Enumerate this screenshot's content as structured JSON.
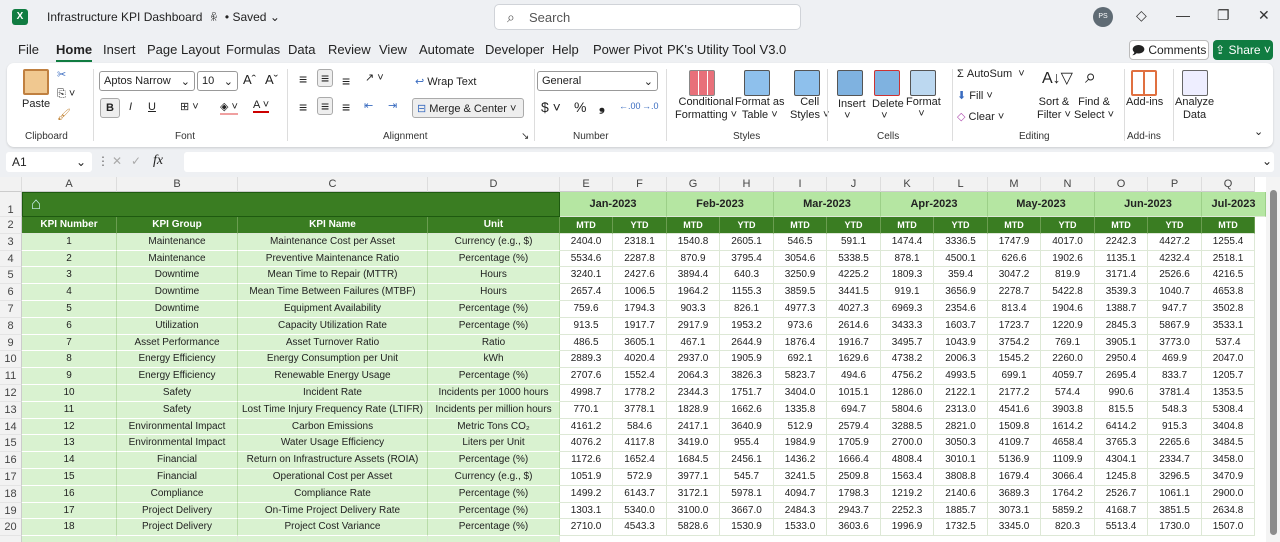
{
  "titlebar": {
    "app_icon": "excel-icon",
    "title": "Infrastructure KPI Dashboard",
    "status": "• Saved",
    "search_placeholder": "Search",
    "avatar": "PS"
  },
  "menu": {
    "tabs": [
      "File",
      "Home",
      "Insert",
      "Page Layout",
      "Formulas",
      "Data",
      "Review",
      "View",
      "Automate",
      "Developer",
      "Help",
      "Power Pivot",
      "PK's Utility Tool V3.0"
    ],
    "active": "Home",
    "comments": "Comments",
    "share": "Share"
  },
  "ribbon": {
    "clipboard": {
      "paste": "Paste",
      "label": "Clipboard"
    },
    "font": {
      "name": "Aptos Narrow",
      "size": "10",
      "label": "Font",
      "bold": "B",
      "italic": "I",
      "underline": "U"
    },
    "alignment": {
      "wrap": "Wrap Text",
      "merge": "Merge & Center",
      "label": "Alignment"
    },
    "number": {
      "format": "General",
      "label": "Number"
    },
    "styles": {
      "conditional": [
        "Conditional",
        "Formatting ˅"
      ],
      "format_table": [
        "Format as",
        "Table ˅"
      ],
      "cell_styles": [
        "Cell",
        "Styles ˅"
      ],
      "label": "Styles"
    },
    "cells": {
      "insert": "Insert",
      "delete": "Delete",
      "format": "Format",
      "label": "Cells"
    },
    "editing": {
      "autosum": "AutoSum",
      "fill": "Fill",
      "clear": "Clear",
      "sort": [
        "Sort &",
        "Filter ˅"
      ],
      "find": [
        "Find &",
        "Select ˅"
      ],
      "label": "Editing"
    },
    "addins": {
      "addins": "Add-ins",
      "label": "Add-ins"
    },
    "analyze": [
      "Analyze",
      "Data"
    ]
  },
  "formula_bar": {
    "name_box": "A1",
    "fx": "fx",
    "value": ""
  },
  "colors": {
    "dark_green": "#3a7d22",
    "light_green": "#d9f2d0",
    "month_band": "#b5e6a2",
    "accent": "#107c41"
  },
  "sheet": {
    "columns": [
      "A",
      "B",
      "C",
      "D",
      "E",
      "F",
      "G",
      "H",
      "I",
      "J",
      "K",
      "L",
      "M",
      "N",
      "O",
      "P",
      "Q"
    ],
    "row_numbers": [
      1,
      2,
      3,
      4,
      5,
      6,
      7,
      8,
      9,
      10,
      11,
      12,
      13,
      14,
      15,
      16,
      17,
      18,
      19,
      20
    ],
    "home_icon": "home-icon",
    "headers": [
      "KPI Number",
      "KPI Group",
      "KPI Name",
      "Unit"
    ],
    "months": [
      "Jan-2023",
      "Feb-2023",
      "Mar-2023",
      "Apr-2023",
      "May-2023",
      "Jun-2023",
      "Jul-2023"
    ],
    "sub": [
      "MTD",
      "YTD"
    ],
    "rows": [
      [
        "1",
        "Maintenance",
        "Maintenance Cost per Asset",
        "Currency (e.g., $)",
        [
          "2404.0",
          "2318.1",
          "1540.8",
          "2605.1",
          "546.5",
          "591.1",
          "1474.4",
          "3336.5",
          "1747.9",
          "4017.0",
          "2242.3",
          "4427.2",
          "1255.4"
        ]
      ],
      [
        "2",
        "Maintenance",
        "Preventive Maintenance Ratio",
        "Percentage (%)",
        [
          "5534.6",
          "2287.8",
          "870.9",
          "3795.4",
          "3054.6",
          "5338.5",
          "878.1",
          "4500.1",
          "626.6",
          "1902.6",
          "1135.1",
          "4232.4",
          "2518.1"
        ]
      ],
      [
        "3",
        "Downtime",
        "Mean Time to Repair (MTTR)",
        "Hours",
        [
          "3240.1",
          "2427.6",
          "3894.4",
          "640.3",
          "3250.9",
          "4225.2",
          "1809.3",
          "359.4",
          "3047.2",
          "819.9",
          "3171.4",
          "2526.6",
          "4216.5"
        ]
      ],
      [
        "4",
        "Downtime",
        "Mean Time Between Failures (MTBF)",
        "Hours",
        [
          "2657.4",
          "1006.5",
          "1964.2",
          "1155.3",
          "3859.5",
          "3441.5",
          "919.1",
          "3656.9",
          "2278.7",
          "5422.8",
          "3539.3",
          "1040.7",
          "4653.8"
        ]
      ],
      [
        "5",
        "Downtime",
        "Equipment Availability",
        "Percentage (%)",
        [
          "759.6",
          "1794.3",
          "903.3",
          "826.1",
          "4977.3",
          "4027.3",
          "6969.3",
          "2354.6",
          "813.4",
          "1904.6",
          "1388.7",
          "947.7",
          "3502.8"
        ]
      ],
      [
        "6",
        "Utilization",
        "Capacity Utilization Rate",
        "Percentage (%)",
        [
          "913.5",
          "1917.7",
          "2917.9",
          "1953.2",
          "973.6",
          "2614.6",
          "3433.3",
          "1603.7",
          "1723.7",
          "1220.9",
          "2845.3",
          "5867.9",
          "3533.1"
        ]
      ],
      [
        "7",
        "Asset Performance",
        "Asset Turnover Ratio",
        "Ratio",
        [
          "486.5",
          "3605.1",
          "467.1",
          "2644.9",
          "1876.4",
          "1916.7",
          "3495.7",
          "1043.9",
          "3754.2",
          "769.1",
          "3905.1",
          "3773.0",
          "537.4"
        ]
      ],
      [
        "8",
        "Energy Efficiency",
        "Energy Consumption per Unit",
        "kWh",
        [
          "2889.3",
          "4020.4",
          "2937.0",
          "1905.9",
          "692.1",
          "1629.6",
          "4738.2",
          "2006.3",
          "1545.2",
          "2260.0",
          "2950.4",
          "469.9",
          "2047.0"
        ]
      ],
      [
        "9",
        "Energy Efficiency",
        "Renewable Energy Usage",
        "Percentage (%)",
        [
          "2707.6",
          "1552.4",
          "2064.3",
          "3826.3",
          "5823.7",
          "494.6",
          "4756.2",
          "4993.5",
          "699.1",
          "4059.7",
          "2695.4",
          "833.7",
          "1205.7"
        ]
      ],
      [
        "10",
        "Safety",
        "Incident Rate",
        "Incidents per 1000 hours",
        [
          "4998.7",
          "1778.2",
          "2344.3",
          "1751.7",
          "3404.0",
          "1015.1",
          "1286.0",
          "2122.1",
          "2177.2",
          "574.4",
          "990.6",
          "3781.4",
          "1353.5"
        ]
      ],
      [
        "11",
        "Safety",
        "Lost Time Injury Frequency Rate (LTIFR)",
        "Incidents per million hours",
        [
          "770.1",
          "3778.1",
          "1828.9",
          "1662.6",
          "1335.8",
          "694.7",
          "5804.6",
          "2313.0",
          "4541.6",
          "3903.8",
          "815.5",
          "548.3",
          "5308.4"
        ]
      ],
      [
        "12",
        "Environmental Impact",
        "Carbon Emissions",
        "Metric Tons CO₂",
        [
          "4161.2",
          "584.6",
          "2417.1",
          "3640.9",
          "512.9",
          "2579.4",
          "3288.5",
          "2821.0",
          "1509.8",
          "1614.2",
          "6414.2",
          "915.3",
          "3404.8"
        ]
      ],
      [
        "13",
        "Environmental Impact",
        "Water Usage Efficiency",
        "Liters per Unit",
        [
          "4076.2",
          "4117.8",
          "3419.0",
          "955.4",
          "1984.9",
          "1705.9",
          "2700.0",
          "3050.3",
          "4109.7",
          "4658.4",
          "3765.3",
          "2265.6",
          "3484.5"
        ]
      ],
      [
        "14",
        "Financial",
        "Return on Infrastructure Assets (ROIA)",
        "Percentage (%)",
        [
          "1172.6",
          "1652.4",
          "1684.5",
          "2456.1",
          "1436.2",
          "1666.4",
          "4808.4",
          "3010.1",
          "5136.9",
          "1109.9",
          "4304.1",
          "2334.7",
          "3458.0"
        ]
      ],
      [
        "15",
        "Financial",
        "Operational Cost per Asset",
        "Currency (e.g., $)",
        [
          "1051.9",
          "572.9",
          "3977.1",
          "545.7",
          "3241.5",
          "2509.8",
          "1563.4",
          "3808.8",
          "1679.4",
          "3066.4",
          "1245.8",
          "3296.5",
          "3470.9"
        ]
      ],
      [
        "16",
        "Compliance",
        "Compliance Rate",
        "Percentage (%)",
        [
          "1499.2",
          "6143.7",
          "3172.1",
          "5978.1",
          "4094.7",
          "1798.3",
          "1219.2",
          "2140.6",
          "3689.3",
          "1764.2",
          "2526.7",
          "1061.1",
          "2900.0"
        ]
      ],
      [
        "17",
        "Project Delivery",
        "On-Time Project Delivery Rate",
        "Percentage (%)",
        [
          "1303.1",
          "5340.0",
          "3100.0",
          "3667.0",
          "2484.3",
          "2943.7",
          "2252.3",
          "1885.7",
          "3073.1",
          "5859.2",
          "4168.7",
          "3851.5",
          "2634.8"
        ]
      ],
      [
        "18",
        "Project Delivery",
        "Project Cost Variance",
        "Percentage (%)",
        [
          "2710.0",
          "4543.3",
          "5828.6",
          "1530.9",
          "1533.0",
          "3603.6",
          "1996.9",
          "1732.5",
          "3345.0",
          "820.3",
          "5513.4",
          "1730.0",
          "1507.0"
        ]
      ]
    ]
  }
}
